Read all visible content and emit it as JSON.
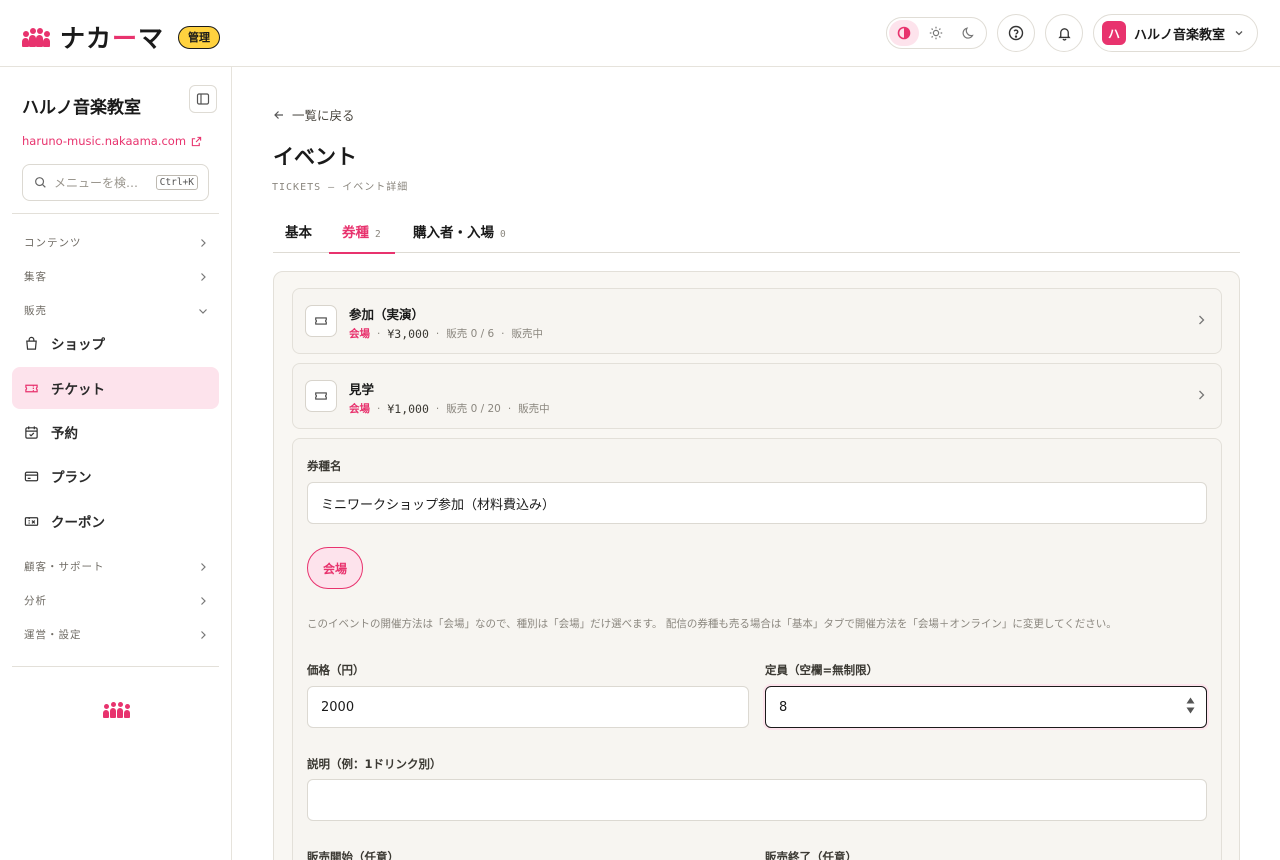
{
  "header": {
    "brand_name_pre": "ナカ",
    "brand_name_dash": "ー",
    "brand_name_post": "マ",
    "admin_badge": "管理",
    "account_avatar": "ハ",
    "account_name": "ハルノ音楽教室"
  },
  "sidebar": {
    "shop_title": "ハルノ音楽教室",
    "shop_url": "haruno-music.nakaama.com",
    "search_placeholder": "メニューを検…",
    "search_shortcut": "Ctrl+K",
    "groups": {
      "contents": "コンテンツ",
      "marketing": "集客",
      "sales": "販売",
      "customers": "顧客・サポート",
      "analytics": "分析",
      "operations": "運営・設定"
    },
    "items": {
      "shop": "ショップ",
      "tickets": "チケット",
      "reservations": "予約",
      "plans": "プラン",
      "coupons": "クーポン"
    }
  },
  "main": {
    "back_label": "一覧に戻る",
    "page_title": "イベント",
    "page_subtitle": "TICKETS — イベント詳細",
    "tabs": [
      {
        "label": "基本",
        "count": ""
      },
      {
        "label": "券種",
        "count": "2"
      },
      {
        "label": "購入者・入場",
        "count": "0"
      }
    ],
    "tickets": [
      {
        "name": "参加（実演）",
        "venue": "会場",
        "price": "¥3,000",
        "sold": "販売 0 / 6",
        "status": "販売中"
      },
      {
        "name": "見学",
        "venue": "会場",
        "price": "¥1,000",
        "sold": "販売 0 / 20",
        "status": "販売中"
      }
    ],
    "editor": {
      "name_label": "券種名",
      "name_value": "ミニワークショップ参加（材料費込み）",
      "venue_chip": "会場",
      "help_text": "このイベントの開催方法は「会場」なので、種別は「会場」だけ選べます。 配信の券種も売る場合は「基本」タブで開催方法を「会場＋オンライン」に変更してください。",
      "price_label": "価格（円）",
      "price_value": "2000",
      "capacity_label": "定員（空欄=無制限）",
      "capacity_value": "8",
      "description_label": "説明（例：1ドリンク別）",
      "description_value": "",
      "sale_start_label": "販売開始（任意）",
      "sale_end_label": "販売終了（任意）"
    }
  },
  "colors": {
    "accent": "#e8336e",
    "accent_soft": "#fde3ec",
    "badge_yellow": "#ffd23f"
  },
  "icons": [
    "half-circle-icon",
    "sun-icon",
    "moon-icon",
    "help-icon",
    "bell-icon",
    "chevron-down-icon",
    "sidebar-toggle-icon",
    "external-link-icon",
    "search-icon",
    "chevron-right-icon",
    "bag-icon",
    "ticket-icon",
    "calendar-icon",
    "card-icon",
    "coupon-icon",
    "arrow-left-icon"
  ]
}
